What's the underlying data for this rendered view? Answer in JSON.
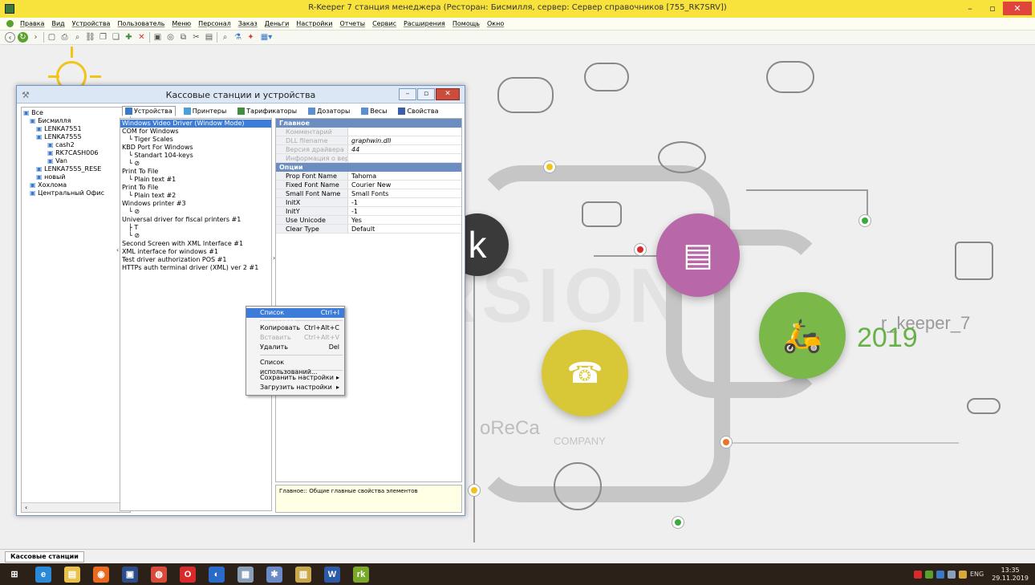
{
  "window": {
    "title": "R-Keeper 7 станция менеджера (Ресторан: Бисмилля, сервер: Сервер справочников [755_RK7SRV])"
  },
  "menu": [
    "Правка",
    "Вид",
    "Устройства",
    "Пользователь",
    "Меню",
    "Персонал",
    "Заказ",
    "Деньги",
    "Настройки",
    "Отчеты",
    "Сервис",
    "Расширения",
    "Помощь",
    "Окно"
  ],
  "background": {
    "demo_word": "DEMO VERSION",
    "brand": "r_keeper_7",
    "year": "2019",
    "horeca": "oReCa",
    "company": "COMPANY",
    "k_logo": "k"
  },
  "dialog": {
    "title": "Кассовые станции и устройства",
    "tabs": [
      {
        "label": "Устройства",
        "icon": "devices-icon",
        "color": "#3a78c8"
      },
      {
        "label": "Принтеры",
        "icon": "printer-icon",
        "color": "#4aa0d8"
      },
      {
        "label": "Тарификаторы",
        "icon": "tariff-icon",
        "color": "#3f8f3f"
      },
      {
        "label": "Дозаторы",
        "icon": "dispenser-icon",
        "color": "#5a8fd0"
      },
      {
        "label": "Весы",
        "icon": "scales-icon",
        "color": "#5a8fd0"
      },
      {
        "label": "Свойства",
        "icon": "properties-icon",
        "color": "#3a5fa8"
      }
    ],
    "tree": [
      "Все",
      "Бисмилля",
      "LENKA7551",
      "LENKA7555",
      "cash2",
      "RK7CASH006",
      "Van",
      "LENKA7555_RESE",
      "новый",
      "Хохлома",
      "Центральный Офис"
    ],
    "devices": [
      {
        "text": "Windows Video Driver (Window Mode)",
        "sel": true
      },
      {
        "text": "COM for Windows"
      },
      {
        "text": "└ Tiger Scales",
        "ind": true
      },
      {
        "text": "KBD Port For Windows"
      },
      {
        "text": "└ Standart 104-keys",
        "ind": true
      },
      {
        "text": "└ ⊘",
        "ind": true
      },
      {
        "text": "Print To File"
      },
      {
        "text": "└ Plain text #1",
        "ind": true
      },
      {
        "text": "Print To File"
      },
      {
        "text": "└ Plain text #2",
        "ind": true
      },
      {
        "text": "Windows printer #3"
      },
      {
        "text": "└ ⊘",
        "ind": true
      },
      {
        "text": "Universal driver for fiscal printers #1"
      },
      {
        "text": "├ T",
        "ind": true
      },
      {
        "text": "└ ⊘",
        "ind": true
      },
      {
        "text": "Second Screen with XML Interface #1"
      },
      {
        "text": "XML interface for windows #1"
      },
      {
        "text": "Test driver authorization POS #1"
      },
      {
        "text": "HTTPs auth terminal driver (XML) ver 2 #1"
      }
    ],
    "props": {
      "cat_main": "Главное",
      "main": [
        {
          "k": "Комментарий",
          "v": "",
          "dim": true
        },
        {
          "k": "DLL filename",
          "v": "graphwin.dll",
          "dim": true,
          "ital": true
        },
        {
          "k": "Версия драйвера",
          "v": "44",
          "dim": true,
          "ital": true
        },
        {
          "k": "Информация о верси",
          "v": "",
          "dim": true
        }
      ],
      "cat_opts": "Опции",
      "opts": [
        {
          "k": "Prop Font Name",
          "v": "Tahoma"
        },
        {
          "k": "Fixed Font Name",
          "v": "Courier New"
        },
        {
          "k": "Small Font Name",
          "v": "Small Fonts"
        },
        {
          "k": "InitX",
          "v": "-1"
        },
        {
          "k": "InitY",
          "v": "-1"
        },
        {
          "k": "Use Unicode",
          "v": "Yes"
        },
        {
          "k": "Clear Type",
          "v": "Default"
        }
      ]
    },
    "hint": "Главное:: Общие главные свойства элементов"
  },
  "context_menu": [
    {
      "label": "Список драйверов",
      "shortcut": "Ctrl+I",
      "hl": true
    },
    {
      "sep": true
    },
    {
      "label": "Копировать",
      "shortcut": "Ctrl+Alt+C"
    },
    {
      "label": "Вставить",
      "shortcut": "Ctrl+Alt+V",
      "dis": true
    },
    {
      "label": "Удалить",
      "shortcut": "Del"
    },
    {
      "sep": true
    },
    {
      "label": "Список использований...",
      "shortcut": ""
    },
    {
      "sep": true
    },
    {
      "label": "Сохранить настройки",
      "shortcut": "▸"
    },
    {
      "label": "Загрузить настройки",
      "shortcut": "▸"
    }
  ],
  "status_tab": "Кассовые станции",
  "taskbar": {
    "apps": [
      {
        "name": "start-button",
        "glyph": "⊞",
        "color": "#2b2118"
      },
      {
        "name": "ie-icon",
        "glyph": "e",
        "color": "#2a8ad8"
      },
      {
        "name": "explorer-icon",
        "glyph": "▤",
        "color": "#e8c24a"
      },
      {
        "name": "firefox-icon",
        "glyph": "◉",
        "color": "#e86a1e"
      },
      {
        "name": "save-app-icon",
        "glyph": "▣",
        "color": "#2d4d8a"
      },
      {
        "name": "chrome-icon",
        "glyph": "◍",
        "color": "#d84a3a"
      },
      {
        "name": "opera-icon",
        "glyph": "O",
        "color": "#d82a2a"
      },
      {
        "name": "app-blue-icon",
        "glyph": "◐",
        "color": "#2a6ac8"
      },
      {
        "name": "calc-icon",
        "glyph": "▦",
        "color": "#8aa0b8"
      },
      {
        "name": "app-gear-icon",
        "glyph": "✱",
        "color": "#6a8ac8"
      },
      {
        "name": "app-chart-icon",
        "glyph": "▥",
        "color": "#c8a84a"
      },
      {
        "name": "word-icon",
        "glyph": "W",
        "color": "#2a5aa8"
      },
      {
        "name": "rk-icon",
        "glyph": "rk",
        "color": "#7aa82a"
      }
    ],
    "lang": "ENG",
    "time": "13:35",
    "date": "29.11.2019"
  }
}
